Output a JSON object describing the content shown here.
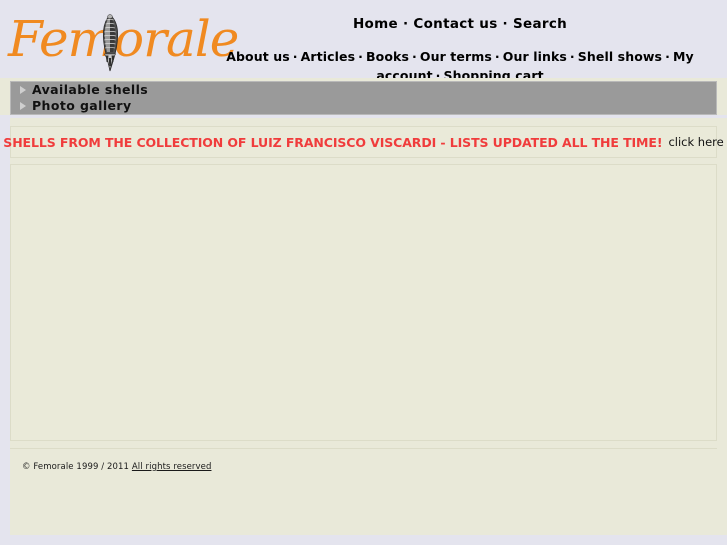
{
  "site": {
    "logo_text": "Femorale",
    "logo_icon": "seashell-icon"
  },
  "nav": {
    "separator": "·",
    "primary": [
      {
        "label": "Home"
      },
      {
        "label": "Contact us"
      },
      {
        "label": "Search"
      }
    ],
    "secondary": [
      {
        "label": "About us"
      },
      {
        "label": "Articles"
      },
      {
        "label": "Books"
      },
      {
        "label": "Our terms"
      },
      {
        "label": "Our links"
      },
      {
        "label": "Shell shows"
      },
      {
        "label": "My account"
      },
      {
        "label": "Shopping cart"
      }
    ]
  },
  "menu_bars": [
    {
      "label": "Available shells",
      "icon": "triangle-right-icon"
    },
    {
      "label": "Photo gallery",
      "icon": "triangle-right-icon"
    }
  ],
  "banner": {
    "headline": "SHELLS FROM THE COLLECTION OF LUIZ FRANCISCO VISCARDI - LISTS UPDATED ALL THE TIME!",
    "link_label": "click here",
    "headline_color": "#f03c3c"
  },
  "footer": {
    "copyright": "© Femorale 1999 / 2011",
    "rights_label": "All rights reserved"
  },
  "colors": {
    "page_background": "#e4e4ee",
    "content_background": "#e9e9d9",
    "panel_background": "#eaead9",
    "panel_border": "#dcdcc8",
    "menu_bar": "#9a9a9a",
    "logo_orange": "#f08a21",
    "banner_red": "#f03c3c"
  }
}
